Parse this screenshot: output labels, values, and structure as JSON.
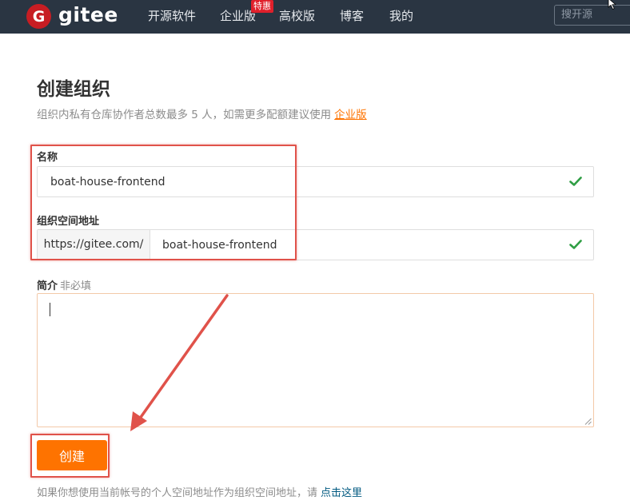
{
  "nav": {
    "logo_letter": "G",
    "brand": "gitee",
    "items": [
      {
        "label": "开源软件"
      },
      {
        "label": "企业版"
      },
      {
        "label": "高校版"
      },
      {
        "label": "博客"
      },
      {
        "label": "我的"
      }
    ],
    "promo_badge": "特惠",
    "search_placeholder": "搜开源"
  },
  "page": {
    "title": "创建组织",
    "subtitle": "组织内私有仓库协作者总数最多 5 人，如需更多配额建议使用",
    "subtitle_link": "企业版"
  },
  "form": {
    "name": {
      "label": "名称",
      "value": "boat-house-frontend"
    },
    "path": {
      "label": "组织空间地址",
      "prefix": "https://gitee.com/",
      "value": "boat-house-frontend"
    },
    "description": {
      "label": "简介",
      "optional_note": "非必填",
      "value": ""
    },
    "submit_label": "创建"
  },
  "footer": {
    "note": "如果你想使用当前帐号的个人空间地址作为组织空间地址，请",
    "link": "点击这里"
  },
  "colors": {
    "nav_bg": "#2a3542",
    "brand_red": "#c71d23",
    "accent_orange": "#fe7300",
    "valid_green": "#2f9e44",
    "annotation_red": "#e0524a",
    "link_blue": "#005980"
  }
}
